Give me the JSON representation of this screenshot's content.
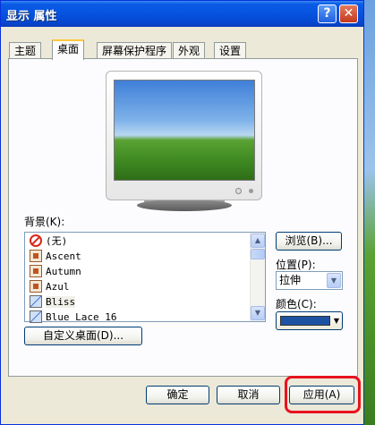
{
  "window": {
    "title": "显示 属性",
    "help_glyph": "?",
    "close_glyph": "✕"
  },
  "tabs": [
    "主题",
    "桌面",
    "屏幕保护程序",
    "外观",
    "设置"
  ],
  "background": {
    "label": "背景(K):",
    "items": [
      "(无)",
      "Ascent",
      "Autumn",
      "Azul",
      "Bliss",
      "Blue Lace 16"
    ],
    "selected": "Bliss"
  },
  "buttons": {
    "browse": "浏览(B)...",
    "customize": "自定义桌面(D)...",
    "ok": "确定",
    "cancel": "取消",
    "apply": "应用(A)"
  },
  "position": {
    "label": "位置(P):",
    "value": "拉伸"
  },
  "color": {
    "label": "颜色(C):",
    "value": "#1d52a3"
  },
  "scroll": {
    "up": "▲",
    "down": "▼"
  }
}
